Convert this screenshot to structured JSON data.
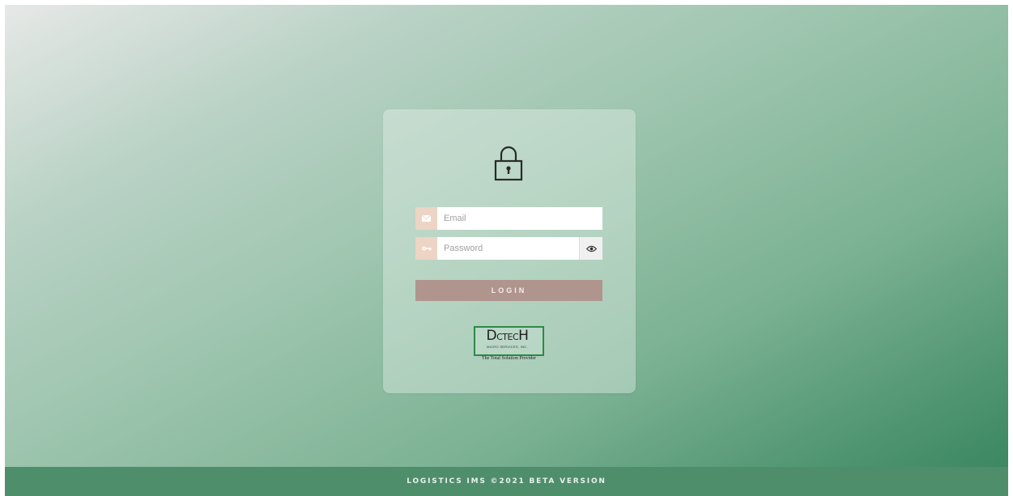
{
  "login": {
    "email_placeholder": "Email",
    "password_placeholder": "Password",
    "button_label": "LOGIN"
  },
  "logo": {
    "wordmark_big_d": "D",
    "wordmark_ctec": "CTEC",
    "wordmark_big_h": "H",
    "subtitle": "MICRO SERVICES, INC.",
    "tagline": "The Total Solution Provider"
  },
  "footer": {
    "text": "LOGISTICS IMS ©2021 BETA VERSION"
  },
  "icons": {
    "lock": "lock-icon",
    "email": "envelope-icon",
    "password": "key-icon",
    "toggle": "eye-icon"
  },
  "colors": {
    "prefix_bg": "#edd4c4",
    "login_button": "#b0958f",
    "footer_bg": "#4f8e6b",
    "logo_border": "#2c8a46"
  }
}
